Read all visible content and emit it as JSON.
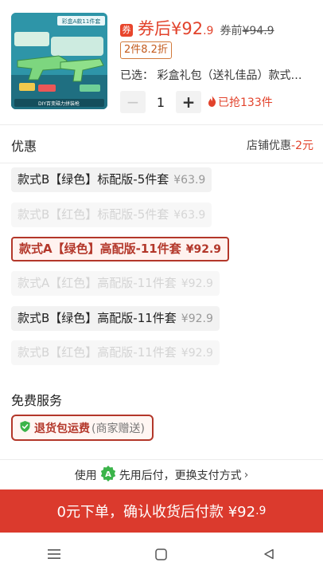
{
  "product": {
    "thumbnail_badge": "彩盒A款11件套",
    "thumbnail_caption": "DIY百变磁力拼装枪",
    "coupon_icon": "券",
    "price_label": "券后",
    "price_symbol": "¥",
    "price_main": "92",
    "price_decimal": ".9",
    "original_label": "券前",
    "original_price": "¥94.9",
    "discount_tag": "2件8.2折",
    "selected_prefix": "已选：",
    "selected_value": "彩盒礼包（送礼佳品）款式…",
    "quantity": "1",
    "minus_label": "−",
    "plus_label": "+",
    "sold_count": "已抢133件"
  },
  "promo": {
    "title": "优惠",
    "store_label": "店铺优惠",
    "store_amount": "-2元"
  },
  "options": [
    {
      "label": "款式B【绿色】标配版-5件套",
      "price": "¥63.9",
      "state": "active"
    },
    {
      "label": "款式B【红色】标配版-5件套",
      "price": "¥63.9",
      "state": "disabled"
    },
    {
      "label": "款式A【绿色】高配版-11件套",
      "price": "¥92.9",
      "state": "selected"
    },
    {
      "label": "款式A【红色】高配版-11件套",
      "price": "¥92.9",
      "state": "disabled"
    },
    {
      "label": "款式B【绿色】高配版-11件套",
      "price": "¥92.9",
      "state": "active"
    },
    {
      "label": "款式B【红色】高配版-11件套",
      "price": "¥92.9",
      "state": "disabled"
    }
  ],
  "service": {
    "title": "免费服务",
    "tag_main": "退货包运费",
    "tag_note": "(商家赠送)"
  },
  "paylater": {
    "prefix": "使用",
    "text": "先用后付，更换支付方式",
    "chevron": "›"
  },
  "cta": {
    "label": "0元下单，确认收货后付款 ¥92",
    "decimal": ".9"
  },
  "icons": {
    "flame": "flame-icon",
    "shield": "shield-check-icon",
    "paylater_logo": "paylater-logo-icon",
    "nav": [
      "menu-icon",
      "home-square-icon",
      "back-triangle-icon"
    ]
  },
  "colors": {
    "accent_red": "#e2432c",
    "cta_red": "#db3a2d",
    "selected_border": "#b3372a",
    "paylater_green": "#3bb44a"
  }
}
